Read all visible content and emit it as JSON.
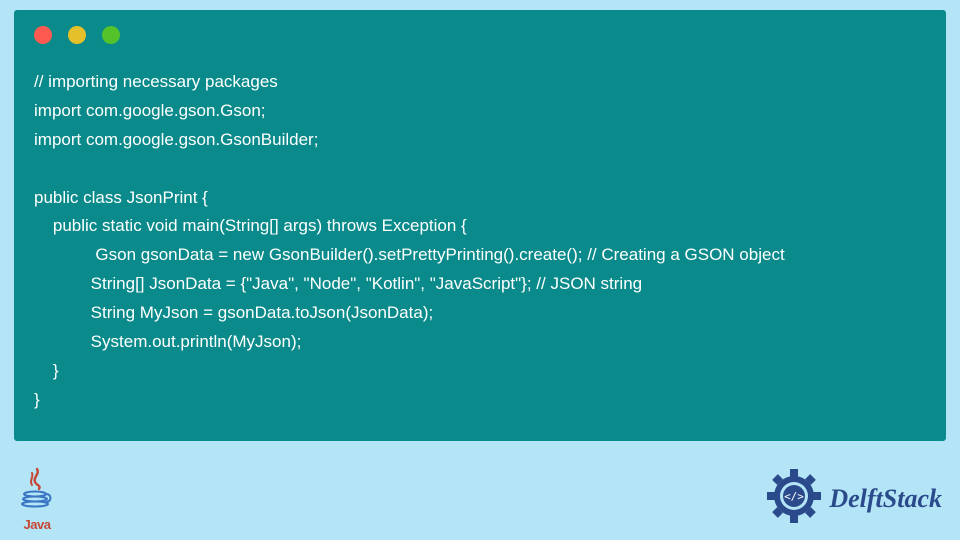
{
  "code": {
    "lines": [
      "// importing necessary packages",
      "import com.google.gson.Gson;",
      "import com.google.gson.GsonBuilder;",
      "",
      "public class JsonPrint {",
      "    public static void main(String[] args) throws Exception {",
      "             Gson gsonData = new GsonBuilder().setPrettyPrinting().create(); // Creating a GSON object",
      "            String[] JsonData = {\"Java\", \"Node\", \"Kotlin\", \"JavaScript\"}; // JSON string",
      "            String MyJson = gsonData.toJson(JsonData);",
      "            System.out.println(MyJson);",
      "    }",
      "}"
    ]
  },
  "footer": {
    "java_label": "Java",
    "brand": "DelftStack"
  },
  "colors": {
    "page_bg": "#b3e5f7",
    "window_bg": "#0a8a8a",
    "brand_blue": "#2b4a8b",
    "java_red": "#c74634"
  }
}
